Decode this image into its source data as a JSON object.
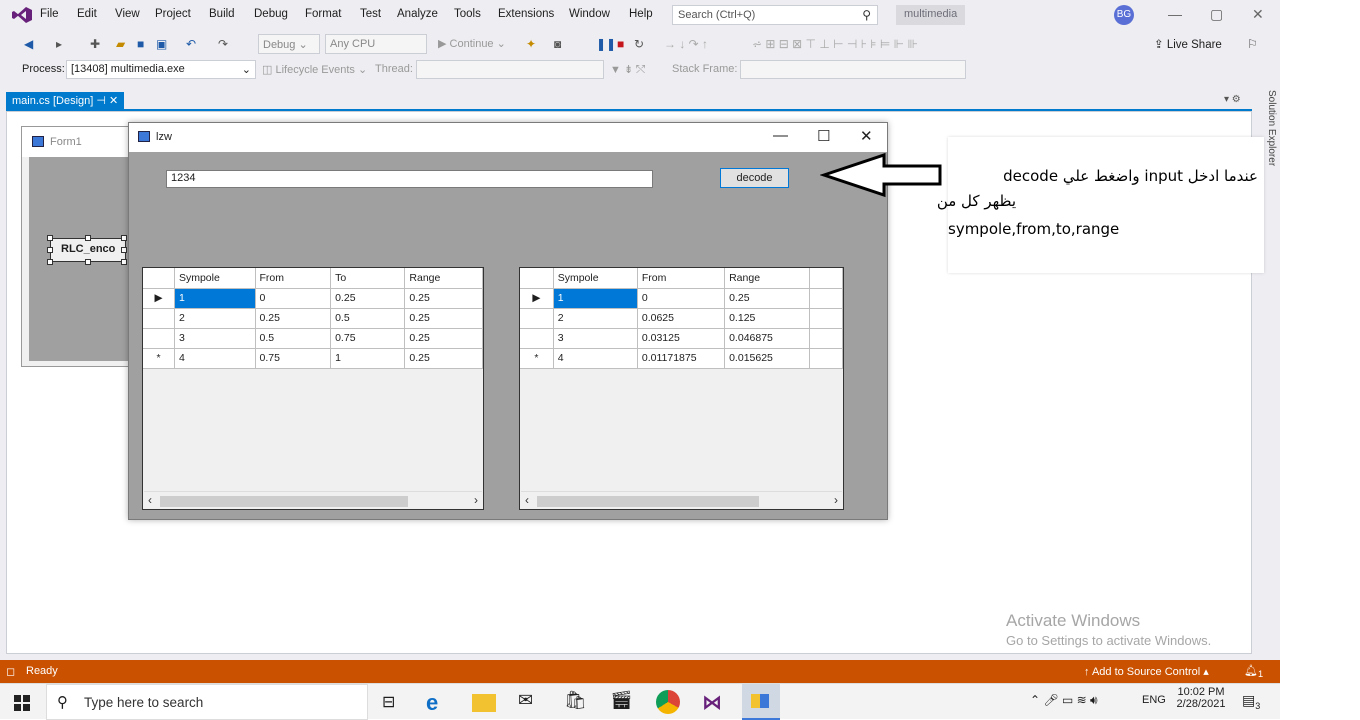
{
  "menubar": {
    "items": [
      "File",
      "Edit",
      "View",
      "Project",
      "Build",
      "Debug",
      "Format",
      "Test",
      "Analyze",
      "Tools",
      "Extensions",
      "Window",
      "Help"
    ],
    "search_placeholder": "Search (Ctrl+Q)",
    "solution_name": "multimedia",
    "avatar_initials": "BG"
  },
  "toolbar": {
    "config": "Debug",
    "platform": "Any CPU",
    "continue_label": "Continue",
    "live_share": "Live Share"
  },
  "debugbar": {
    "process_label": "Process:",
    "process_value": "[13408] multimedia.exe",
    "lifecycle_label": "Lifecycle Events",
    "thread_label": "Thread:",
    "stack_frame_label": "Stack Frame:"
  },
  "editor": {
    "doc_tab": "main.cs [Design]",
    "side_tab": "Solution Explorer"
  },
  "form1": {
    "title": "Form1",
    "button_label": "RLC_enco"
  },
  "lzw": {
    "title": "lzw",
    "input_value": "1234",
    "decode_label": "decode",
    "grid1": {
      "headers": [
        "Sympole",
        "From",
        "To",
        "Range"
      ],
      "rows": [
        {
          "marker": "▶",
          "cells": [
            "1",
            "0",
            "0.25",
            "0.25"
          ]
        },
        {
          "marker": "",
          "cells": [
            "2",
            "0.25",
            "0.5",
            "0.25"
          ]
        },
        {
          "marker": "",
          "cells": [
            "3",
            "0.5",
            "0.75",
            "0.25"
          ]
        },
        {
          "marker": "*",
          "cells": [
            "4",
            "0.75",
            "1",
            "0.25"
          ]
        }
      ]
    },
    "grid2": {
      "headers": [
        "Sympole",
        "From",
        "Range"
      ],
      "rows": [
        {
          "marker": "▶",
          "cells": [
            "1",
            "0",
            "0.25"
          ]
        },
        {
          "marker": "",
          "cells": [
            "2",
            "0.0625",
            "0.125"
          ]
        },
        {
          "marker": "",
          "cells": [
            "3",
            "0.03125",
            "0.046875"
          ]
        },
        {
          "marker": "*",
          "cells": [
            "4",
            "0.01171875",
            "0.015625"
          ]
        }
      ]
    }
  },
  "annotation": {
    "line1": "عندما ادخل  input واضغط علي decode",
    "line2": "يظهر كل من",
    "line3": "sympole,from,to,range"
  },
  "activate": {
    "title": "Activate Windows",
    "subtitle": "Go to Settings to activate Windows."
  },
  "statusbar": {
    "ready": "Ready",
    "source_control": "Add to Source Control",
    "notifications": "1"
  },
  "taskbar": {
    "search_placeholder": "Type here to search",
    "language": "ENG",
    "time": "10:02 PM",
    "date": "2/28/2021",
    "notification_count": "3"
  }
}
